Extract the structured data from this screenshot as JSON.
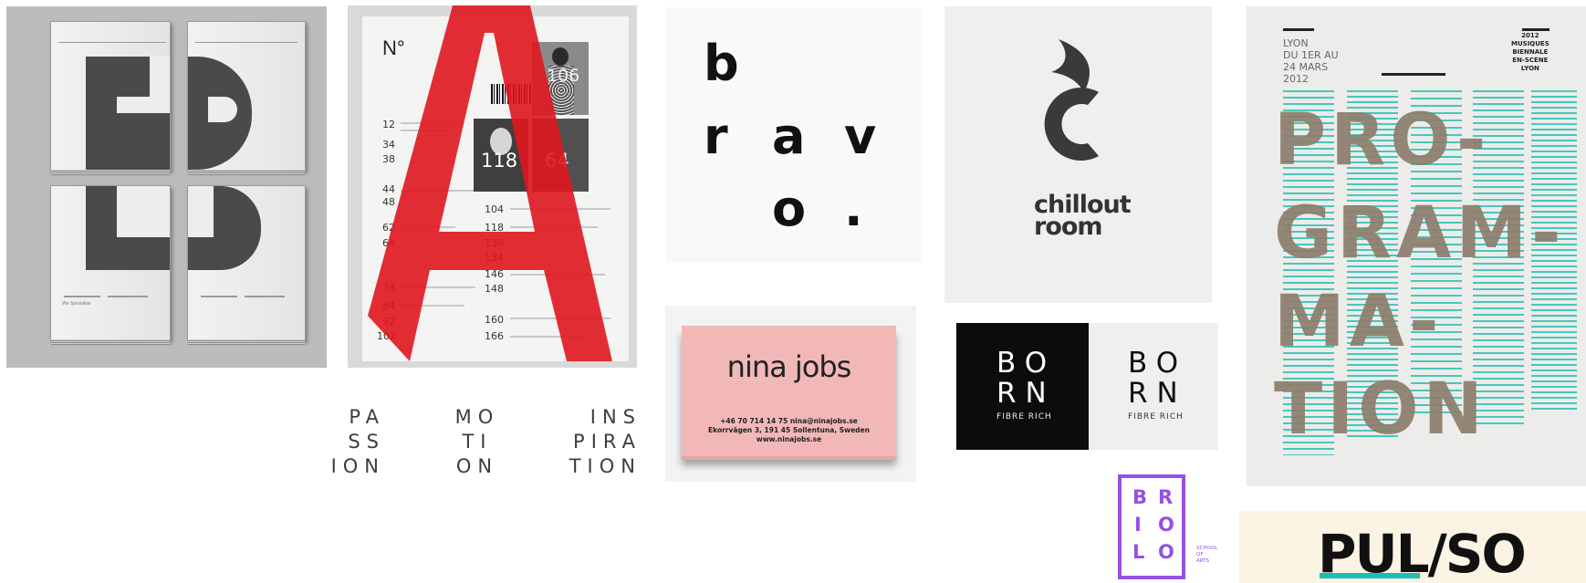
{
  "colors": {
    "red": "#e0161f",
    "pink": "#f2b8b8",
    "purple": "#9650e4",
    "teal": "#1bbfb1",
    "poster_text": "#8d7e6d"
  },
  "newspaper": {
    "footer_left": "We Specialise",
    "footer_right": ""
  },
  "magazine": {
    "number_label": "N°",
    "cover_code": "106",
    "photo_a": "118",
    "photo_b": "64",
    "left_numbers": [
      "12",
      "34",
      "38",
      "44",
      "48",
      "62",
      "64",
      "74",
      "84",
      "92",
      "102"
    ],
    "right_numbers": [
      "104",
      "118",
      "130",
      "134",
      "146",
      "148",
      "160",
      "166"
    ]
  },
  "bravo": {
    "letters": [
      "b",
      "r",
      "a",
      "v",
      "o",
      "."
    ]
  },
  "nina": {
    "logo": "nina jobs",
    "contact_line_1": "+46 70 714 14 75  nina@ninajobs.se",
    "contact_line_2": "Ekorrvägen 3, 191 45 Sollentuna, Sweden",
    "contact_line_3": "www.ninajobs.se"
  },
  "chillout": {
    "line_1": "chillout",
    "line_2": "room"
  },
  "born": {
    "line_1": "BO",
    "line_2": "RN",
    "sub": "FIBRE RICH"
  },
  "poster": {
    "place_dates": "LYON\nDU 1ER AU\n24 MARS\n2012",
    "festival": "2012\nMUSIQUES\nBIENNALE\nEN-SCÈNE\nLYON",
    "lines": [
      "PRO-",
      "GRAM-",
      "MA-",
      "TION"
    ]
  },
  "passion": {
    "col_1": "PA\nSS\nION",
    "col_2": "MO\nTI\nON",
    "col_3": "INS\nPIRA\nTION"
  },
  "briolo": {
    "letters": [
      "B",
      "R",
      "I",
      "O",
      "L",
      "O"
    ],
    "tag": "SCHOOL\nOF\nARTS"
  },
  "pulso": {
    "text": "PUL/SO"
  }
}
